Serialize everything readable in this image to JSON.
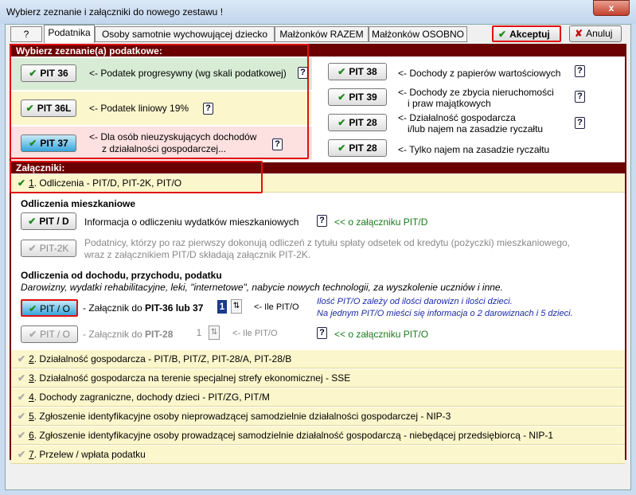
{
  "window": {
    "title": "Wybierz zeznanie i załączniki do nowego zestawu !",
    "close": "x"
  },
  "tabs": [
    {
      "label": "?"
    },
    {
      "label": "Podatnika"
    },
    {
      "label": "Osoby samotnie wychowującej dziecko"
    },
    {
      "label": "Małżonków RAZEM"
    },
    {
      "label": "Małżonków OSOBNO"
    }
  ],
  "toolbar": {
    "accept": "Akceptuj",
    "cancel": "Anuluj"
  },
  "returns": {
    "header": "Wybierz zeznanie(a) podatkowe:",
    "left": [
      {
        "button": "PIT 36",
        "text": "<- Podatek progresywny (wg skali podatkowej)"
      },
      {
        "button": "PIT 36L",
        "text": "<- Podatek liniowy 19%"
      },
      {
        "button": "PIT 37",
        "text": "<- Dla osób nieuzyskujących dochodów",
        "text2": "z działalności gospodarczej..."
      }
    ],
    "right": [
      {
        "button": "PIT 38",
        "text": "<- Dochody z papierów wartościowych"
      },
      {
        "button": "PIT 39",
        "text": "<- Dochody ze zbycia nieruchomości",
        "text2": "i praw majątkowych"
      },
      {
        "button": "PIT 28",
        "text": "<- Działalność gospodarcza",
        "text2": "i/lub najem na zasadzie ryczałtu"
      },
      {
        "button": "PIT 28",
        "text": "<- Tylko najem na zasadzie ryczałtu"
      }
    ],
    "help": "?"
  },
  "attachments": {
    "header": "Załączniki:",
    "items": [
      {
        "num": "1",
        "label": ". Odliczenia - PIT/D, PIT-2K, PIT/O"
      },
      {
        "num": "2",
        "label": ". Działalność gospodarcza - PIT/B, PIT/Z, PIT-28/A, PIT-28/B"
      },
      {
        "num": "3",
        "label": ". Działalność gospodarcza na terenie specjalnej strefy ekonomicznej - SSE"
      },
      {
        "num": "4",
        "label": ". Dochody zagraniczne, dochody dzieci - PIT/ZG, PIT/M"
      },
      {
        "num": "5",
        "label": ". Zgłoszenie identyfikacyjne osoby nieprowadzącej samodzielnie działalności gospodarczej - NIP-3"
      },
      {
        "num": "6",
        "label": ". Zgłoszenie identyfikacyjne osoby prowadzącej samodzielnie działalność gospodarczą - niebędącej przedsiębiorcą - NIP-1"
      },
      {
        "num": "7",
        "label": ". Przelew / wpłata podatku"
      }
    ]
  },
  "housing": {
    "title": "Odliczenia mieszkaniowe",
    "pitd_button": "PIT / D",
    "pitd_text": "Informacja o odliczeniu wydatków mieszkaniowych",
    "pitd_link": "<< o załączniku PIT/D",
    "pit2k_button": "PIT-2K",
    "pit2k_text": "Podatnicy, którzy po raz pierwszy dokonują odliczeń z tytułu spłaty odsetek od kredytu (pożyczki) mieszkaniowego,",
    "pit2k_text2": "wraz z załącznikiem PIT/D składają załącznik PIT-2K."
  },
  "income": {
    "title": "Odliczenia od dochodu, przychodu, podatku",
    "subtitle": "Darowizny, wydatki rehabilitacyjne, leki, \"internetowe\", nabycie nowych technologii,  za wyszkolenie uczniów i inne.",
    "pito1_button": "PIT / O",
    "pito1_prefix": "- Załącznik do ",
    "pito1_bold": "PIT-36 lub 37",
    "pito1_count": "1",
    "count_label": "<- Ile PIT/O",
    "note1": "Ilość PIT/O zależy od ilości darowizn i ilości dzieci.",
    "note2": "Na jednym PIT/O mieści się informacja o 2 darowiznach i 5 dzieci.",
    "pito2_button": "PIT / O",
    "pito2_prefix": "- Załącznik do ",
    "pito2_bold": "PIT-28",
    "pito2_count": "1",
    "pito_link": "<< o załączniku PIT/O"
  },
  "colors": {
    "header": "#6b0000",
    "highlight": "#e01010",
    "green_row": "#d8ecd5",
    "yellow_row": "#fcf6cc",
    "pink_row": "#fde0e0"
  }
}
